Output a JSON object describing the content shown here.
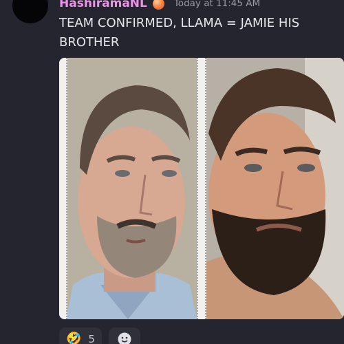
{
  "message": {
    "author": "HashiramaNL",
    "timestamp": "Today at 11:45 AM",
    "text": "TEAM CONFIRMED, LLAMA = JAMIE HIS BROTHER",
    "user_badge_icon": "peach-icon",
    "author_color": "#ec92e8"
  },
  "attachment": {
    "type": "image",
    "panels": [
      "man-with-gray-beard-photo",
      "man-with-dark-beard-photo"
    ]
  },
  "reactions": [
    {
      "emoji": "🤣",
      "icon": "rofl-emoji-icon",
      "count": "5"
    }
  ],
  "add_reaction": {
    "icon": "smiley-add-reaction-icon"
  }
}
